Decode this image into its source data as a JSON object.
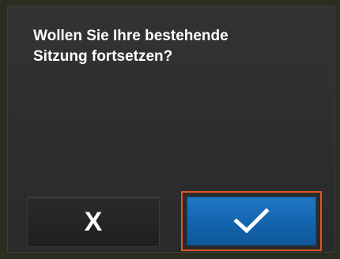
{
  "dialog": {
    "message_line1": "Wollen Sie Ihre bestehende",
    "message_line2": "Sitzung fortsetzen?"
  },
  "buttons": {
    "cancel_label": "X",
    "cancel_icon": "close-icon",
    "confirm_icon": "checkmark-icon"
  },
  "colors": {
    "confirm_blue": "#1a6fbb",
    "focus_outline": "#e0561f",
    "dialog_background": "#303030"
  }
}
